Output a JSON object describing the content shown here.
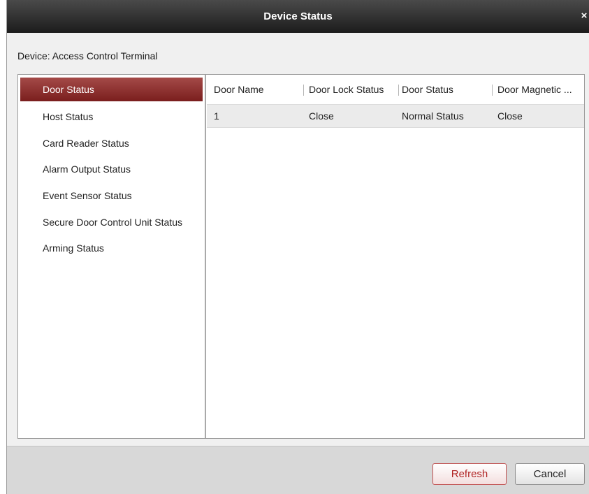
{
  "window": {
    "title": "Device Status",
    "close_label": "×"
  },
  "device": {
    "label": "Device: Access Control Terminal"
  },
  "sidebar": {
    "items": [
      {
        "label": "Door Status",
        "active": true
      },
      {
        "label": "Host Status",
        "active": false
      },
      {
        "label": "Card Reader Status",
        "active": false
      },
      {
        "label": "Alarm Output Status",
        "active": false
      },
      {
        "label": "Event Sensor Status",
        "active": false
      },
      {
        "label": "Secure Door Control Unit Status",
        "active": false
      },
      {
        "label": "Arming Status",
        "active": false
      }
    ]
  },
  "table": {
    "columns": [
      "Door Name",
      "Door Lock Status",
      "Door Status",
      "Door Magnetic ..."
    ],
    "rows": [
      [
        "1",
        "Close",
        "Normal Status",
        "Close"
      ]
    ]
  },
  "footer": {
    "refresh_label": "Refresh",
    "cancel_label": "Cancel"
  },
  "colors": {
    "accent": "#8b2c2b",
    "titlebar": "#2a2a2a",
    "selected_text": "#ffffff"
  }
}
